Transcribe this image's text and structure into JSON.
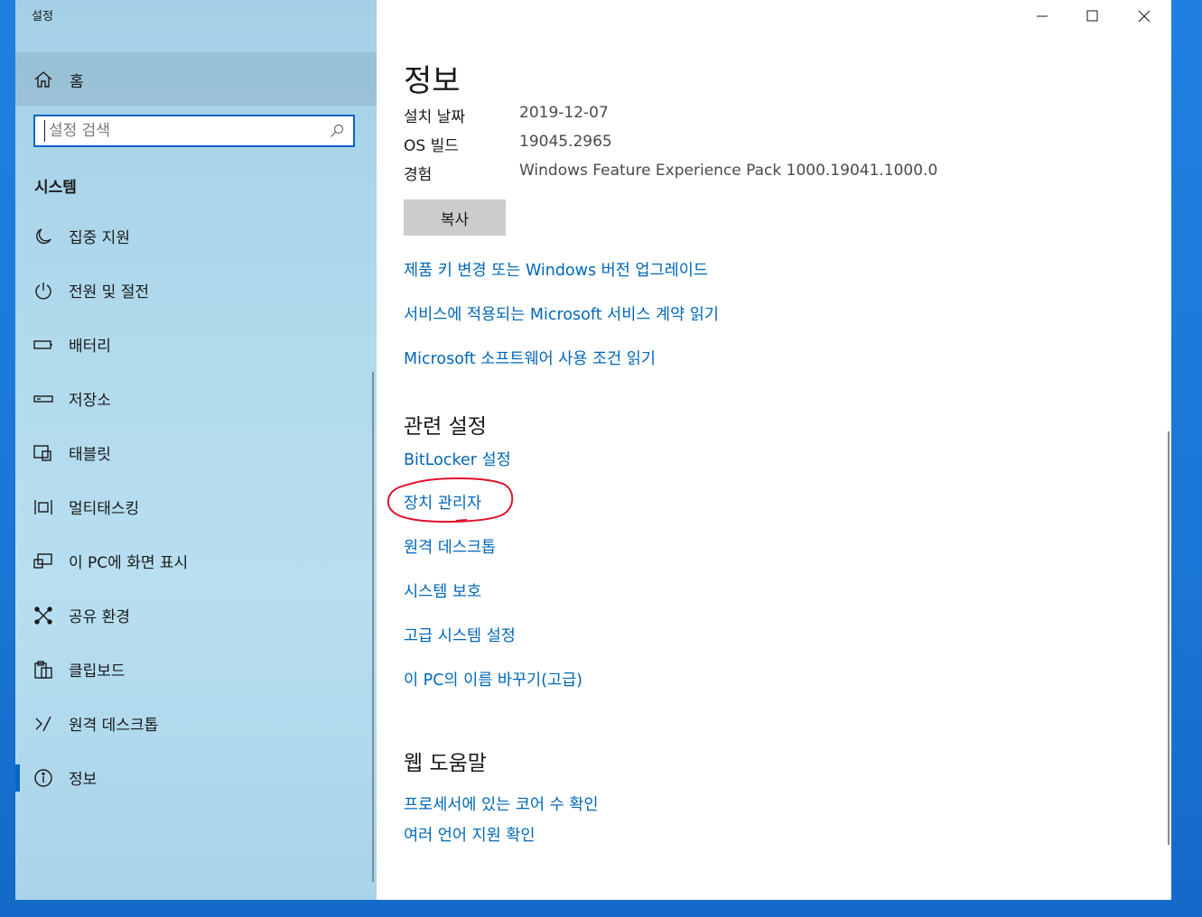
{
  "window": {
    "title": "설정"
  },
  "sidebar": {
    "home_label": "홈",
    "search_placeholder": "설정 검색",
    "section_title": "시스템",
    "items": [
      {
        "label": "집중 지원",
        "icon": "moon-icon"
      },
      {
        "label": "전원 및 절전",
        "icon": "power-icon"
      },
      {
        "label": "배터리",
        "icon": "battery-icon"
      },
      {
        "label": "저장소",
        "icon": "storage-icon"
      },
      {
        "label": "태블릿",
        "icon": "tablet-icon"
      },
      {
        "label": "멀티태스킹",
        "icon": "multitasking-icon"
      },
      {
        "label": "이 PC에 화면 표시",
        "icon": "project-icon"
      },
      {
        "label": "공유 환경",
        "icon": "shared-experiences-icon"
      },
      {
        "label": "클립보드",
        "icon": "clipboard-icon"
      },
      {
        "label": "원격 데스크톱",
        "icon": "remote-desktop-icon"
      },
      {
        "label": "정보",
        "icon": "info-icon",
        "active": true
      }
    ]
  },
  "main": {
    "title": "정보",
    "specs": [
      {
        "key": "설치 날짜",
        "value": "2019-12-07"
      },
      {
        "key": "OS 빌드",
        "value": "19045.2965"
      },
      {
        "key": "경험",
        "value": "Windows Feature Experience Pack 1000.19041.1000.0"
      }
    ],
    "copy_label": "복사",
    "links": [
      "제품 키 변경 또는 Windows 버전 업그레이드",
      "서비스에 적용되는 Microsoft 서비스 계약 읽기",
      "Microsoft 소프트웨어 사용 조건 읽기"
    ],
    "related_title": "관련 설정",
    "related_links": [
      "BitLocker 설정",
      "장치 관리자",
      "원격 데스크톱",
      "시스템 보호",
      "고급 시스템 설정",
      "이 PC의 이름 바꾸기(고급)"
    ],
    "web_help_title": "웹 도움말",
    "web_help_links": [
      "프로세서에 있는 코어 수 확인",
      "여러 언어 지원 확인"
    ]
  },
  "colors": {
    "accent": "#0067b8",
    "annotation": "#e0102a",
    "desktop": "#1b78d8"
  }
}
